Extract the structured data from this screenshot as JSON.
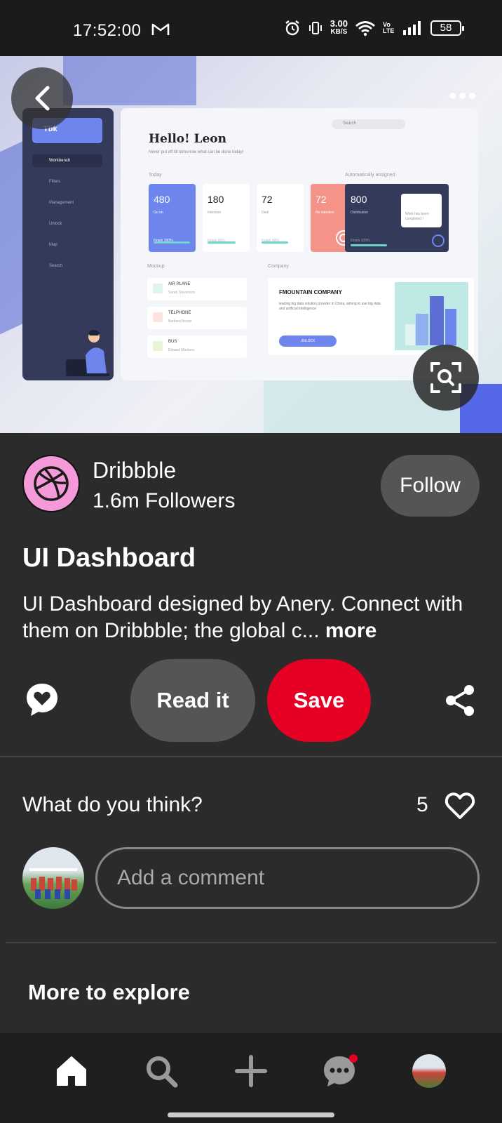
{
  "status_bar": {
    "time": "17:52:00",
    "net_speed_value": "3.00",
    "net_speed_unit": "KB/S",
    "volte": "Vo LTE",
    "battery": "58"
  },
  "hero": {
    "mock_logo": "Tbk",
    "mock_greeting": "Hello!  Leon",
    "mock_subtitle": "Never put off till tomorrow what can be done today!",
    "mock_sidebar": [
      "Workbench",
      "Filters",
      "Management",
      "Unlock",
      "Map",
      "Search"
    ],
    "mock_search": "Search",
    "mock_today_label": "Today",
    "mock_auto_label": "Automatically assigned",
    "mock_cards": [
      {
        "num": "480",
        "label": "Go on",
        "done": "Finish 100%"
      },
      {
        "num": "180",
        "label": "Intention",
        "done": "Finish 80%"
      },
      {
        "num": "72",
        "label": "Deal",
        "done": "Finish 48%"
      },
      {
        "num": "72",
        "label": "No intention",
        "done": ""
      }
    ],
    "mock_dark_card": {
      "num": "800",
      "label": "Distribution",
      "done": "Finish 100%",
      "bubble": "Work has been completed !"
    },
    "mock_mockup_label": "Mockup",
    "mock_company_label": "Company",
    "mock_rows": [
      {
        "title": "AIR PLANE",
        "sub": "Sarah Stevenson"
      },
      {
        "title": "TELPHONE",
        "sub": "Barbara Brown"
      },
      {
        "title": "BUS",
        "sub": "Edward Martinez"
      }
    ],
    "mock_company_title": "FMOUNTAIN COMPANY",
    "mock_company_desc": "leading big data solution provider in China, aiming to use big data and artificial intelligence",
    "mock_company_btn": "UNLOCK"
  },
  "creator": {
    "name": "Dribbble",
    "followers": "1.6m Followers",
    "follow_label": "Follow"
  },
  "pin": {
    "title": "UI Dashboard",
    "description": "UI Dashboard designed by Anery. Connect with them on Dribbble; the global c... ",
    "more_label": "more"
  },
  "actions": {
    "read_label": "Read it",
    "save_label": "Save"
  },
  "comments": {
    "prompt": "What do you think?",
    "like_count": "5",
    "input_placeholder": "Add a comment"
  },
  "explore": {
    "title": "More to explore"
  },
  "colors": {
    "save": "#e60023",
    "surface": "#2b2b2b",
    "pill": "#555555",
    "creator_avatar": "#f49ad8"
  },
  "icons": {
    "back": "back-arrow-icon",
    "more": "more-dots-icon",
    "lens": "visual-search-icon",
    "react": "heart-chat-icon",
    "share": "share-icon",
    "like": "heart-outline-icon",
    "nav": [
      "home-icon",
      "search-icon",
      "plus-icon",
      "chat-icon",
      "profile-avatar"
    ]
  }
}
